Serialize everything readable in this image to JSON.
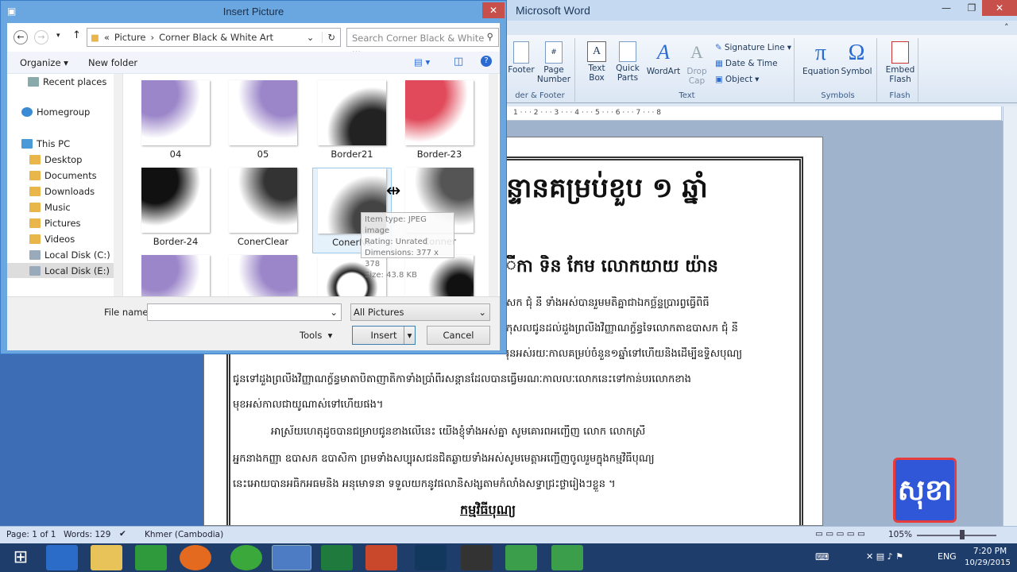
{
  "word": {
    "title": "Microsoft Word",
    "controls": {
      "min": "—",
      "max": "❐",
      "close": "✕"
    },
    "ribbon": {
      "header_footer": {
        "footer": "Footer",
        "page_number": "Page Number",
        "label": "der & Footer"
      },
      "text_group": {
        "text_box": "Text Box",
        "quick_parts": "Quick Parts",
        "wordart": "WordArt",
        "drop_cap": "Drop Cap",
        "signature_line": "Signature Line",
        "date_time": "Date & Time",
        "object": "Object",
        "label": "Text"
      },
      "symbols": {
        "equation": "Equation",
        "symbol": "Symbol",
        "label": "Symbols",
        "pi": "π",
        "omega": "Ω"
      },
      "flash": {
        "embed": "Embed Flash",
        "label": "Flash"
      }
    },
    "ruler": "1 · · · 2 · · · 3 · · · 4 · · · 5 · · · 6 · · · 7 · · · 8",
    "document": {
      "line1": "ន្ទានគម្រប់ខួប ១ ឆ្នាំ",
      "line2": "ីកា ទិន កែម លោកយាយ យ៉ាន",
      "line3": "សក ជុំ នី ទាំងអស់បានរួមមតិគ្នាជាឯកច្ឆ័ន្ទប្រារព្វធ្វើពិធី",
      "line4": "កុសលជូនដល់ដួងព្រលឹងវិញ្ញាណក្ខ័ន្ធទៃលោកតាឧបាសក ជុំ នី",
      "line5": "រុនអស់រយៈកាលគម្រប់ចំនួន១ឆ្នាំទៅហើយនិងដើម្បីឧទ្ទិសបុណ្យ",
      "line6": "ជូនទៅដួងព្រលឹងវិញ្ញាណក្ខ័ន្ធមាតាបិតាញាតិកាទាំងប្រាំពីរសន្តានដែលបានធ្វើមរណៈកាលលៈលោកនេះទៅកាន់បរលោកខាង",
      "line7": "មុខអស់កាលជាយូណាស់ទៅហើយផង។",
      "line8": "អាស្រ័យហេតុដូចបានជម្រាបជូនខាងលើនេះ យើងខ្ញុំទាំងអស់គ្នា សូមគោរពអញ្ជើញ លោក លោកស្រី",
      "line9": "អ្នកនាងកញ្ញា ឧបាសក ឧបាសិកា ព្រមទាំងសប្បុរសជនជិតឆ្ងាយទាំងអស់សូមមេត្តាអញ្ជើញចូលរួមក្នុងកម្មវិធីបុណ្យ",
      "line10": "នេះអោយបានអធិកអធមនិង អនុមោទនា ទទួលយកនូវផលានិសង្សតាមកំលាំងសទ្ធាជ្រះថ្លារៀងៗខ្លួន ។",
      "line11": "កម្មវិធីបុណ្យ"
    },
    "logo_text": "សុខា",
    "status": {
      "page": "Page: 1 of 1",
      "words": "Words: 129",
      "language": "Khmer (Cambodia)",
      "zoom": "105%"
    }
  },
  "dialog": {
    "title": "Insert Picture",
    "breadcrumb": [
      "«",
      "Picture",
      "Corner Black & White Art"
    ],
    "search_placeholder": "Search Corner Black & White ...",
    "organize": "Organize",
    "new_folder": "New folder",
    "nav": {
      "recent": "Recent places",
      "homegroup": "Homegroup",
      "this_pc": "This PC",
      "desktop": "Desktop",
      "documents": "Documents",
      "downloads": "Downloads",
      "music": "Music",
      "pictures": "Pictures",
      "videos": "Videos",
      "local_c": "Local Disk (C:)",
      "local_e": "Local Disk (E:)"
    },
    "thumbnails": [
      "04",
      "05",
      "Border21",
      "Border-23",
      "Border-24",
      "ConerClear",
      "ConerNe",
      "Conner"
    ],
    "tooltip": {
      "type": "Item type: JPEG image",
      "rating": "Rating: Unrated",
      "dims": "Dimensions: 377 x 378",
      "size": "Size: 43.8 KB"
    },
    "file_name_label": "File name:",
    "file_name_value": "",
    "filter": "All Pictures",
    "tools": "Tools",
    "insert": "Insert",
    "cancel": "Cancel"
  },
  "taskbar": {
    "lang": "ENG",
    "time": "7:20 PM",
    "date": "10/29/2015"
  }
}
